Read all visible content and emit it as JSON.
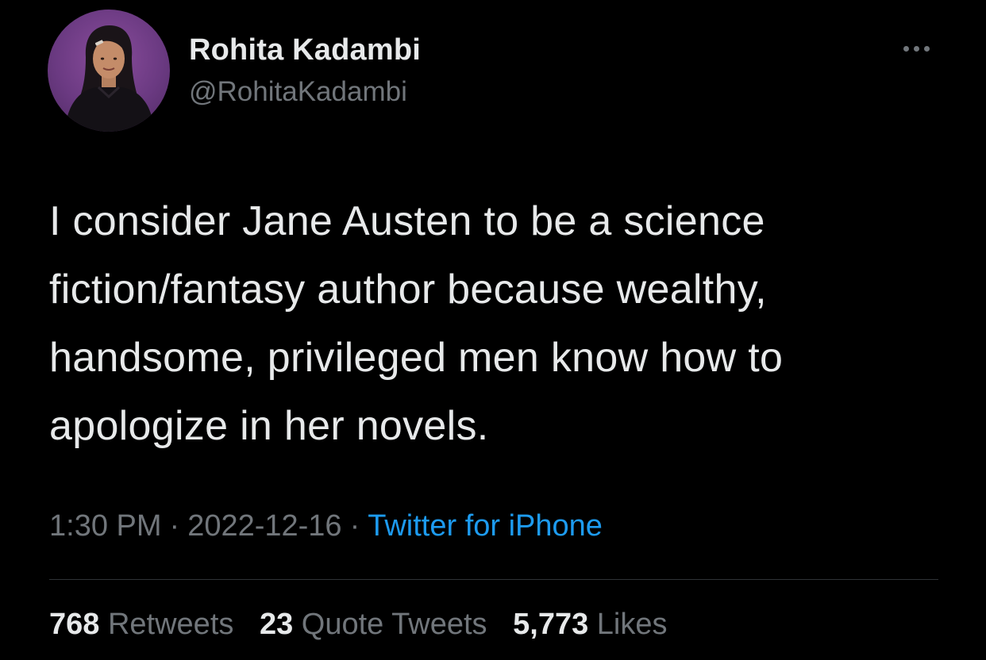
{
  "author": {
    "name": "Rohita Kadambi",
    "handle": "@RohitaKadambi"
  },
  "tweet": {
    "lines": [
      "I consider Jane Austen to be a science",
      "fiction/fantasy author because wealthy,",
      "handsome, privileged men know how to",
      "apologize in her novels."
    ]
  },
  "meta": {
    "time": "1:30 PM",
    "separator": "·",
    "date": "2022-12-16",
    "source": "Twitter for iPhone"
  },
  "stats": {
    "retweets_count": "768",
    "retweets_label": "Retweets",
    "quotes_count": "23",
    "quotes_label": "Quote Tweets",
    "likes_count": "5,773",
    "likes_label": "Likes"
  },
  "colors": {
    "background": "#000000",
    "primary_text": "#e7e9ea",
    "secondary_text": "#71767b",
    "link": "#1d9bf0",
    "divider": "#2f3336",
    "avatar_bg": "#6b3a82"
  },
  "icons": {
    "more": "more-options-icon"
  }
}
